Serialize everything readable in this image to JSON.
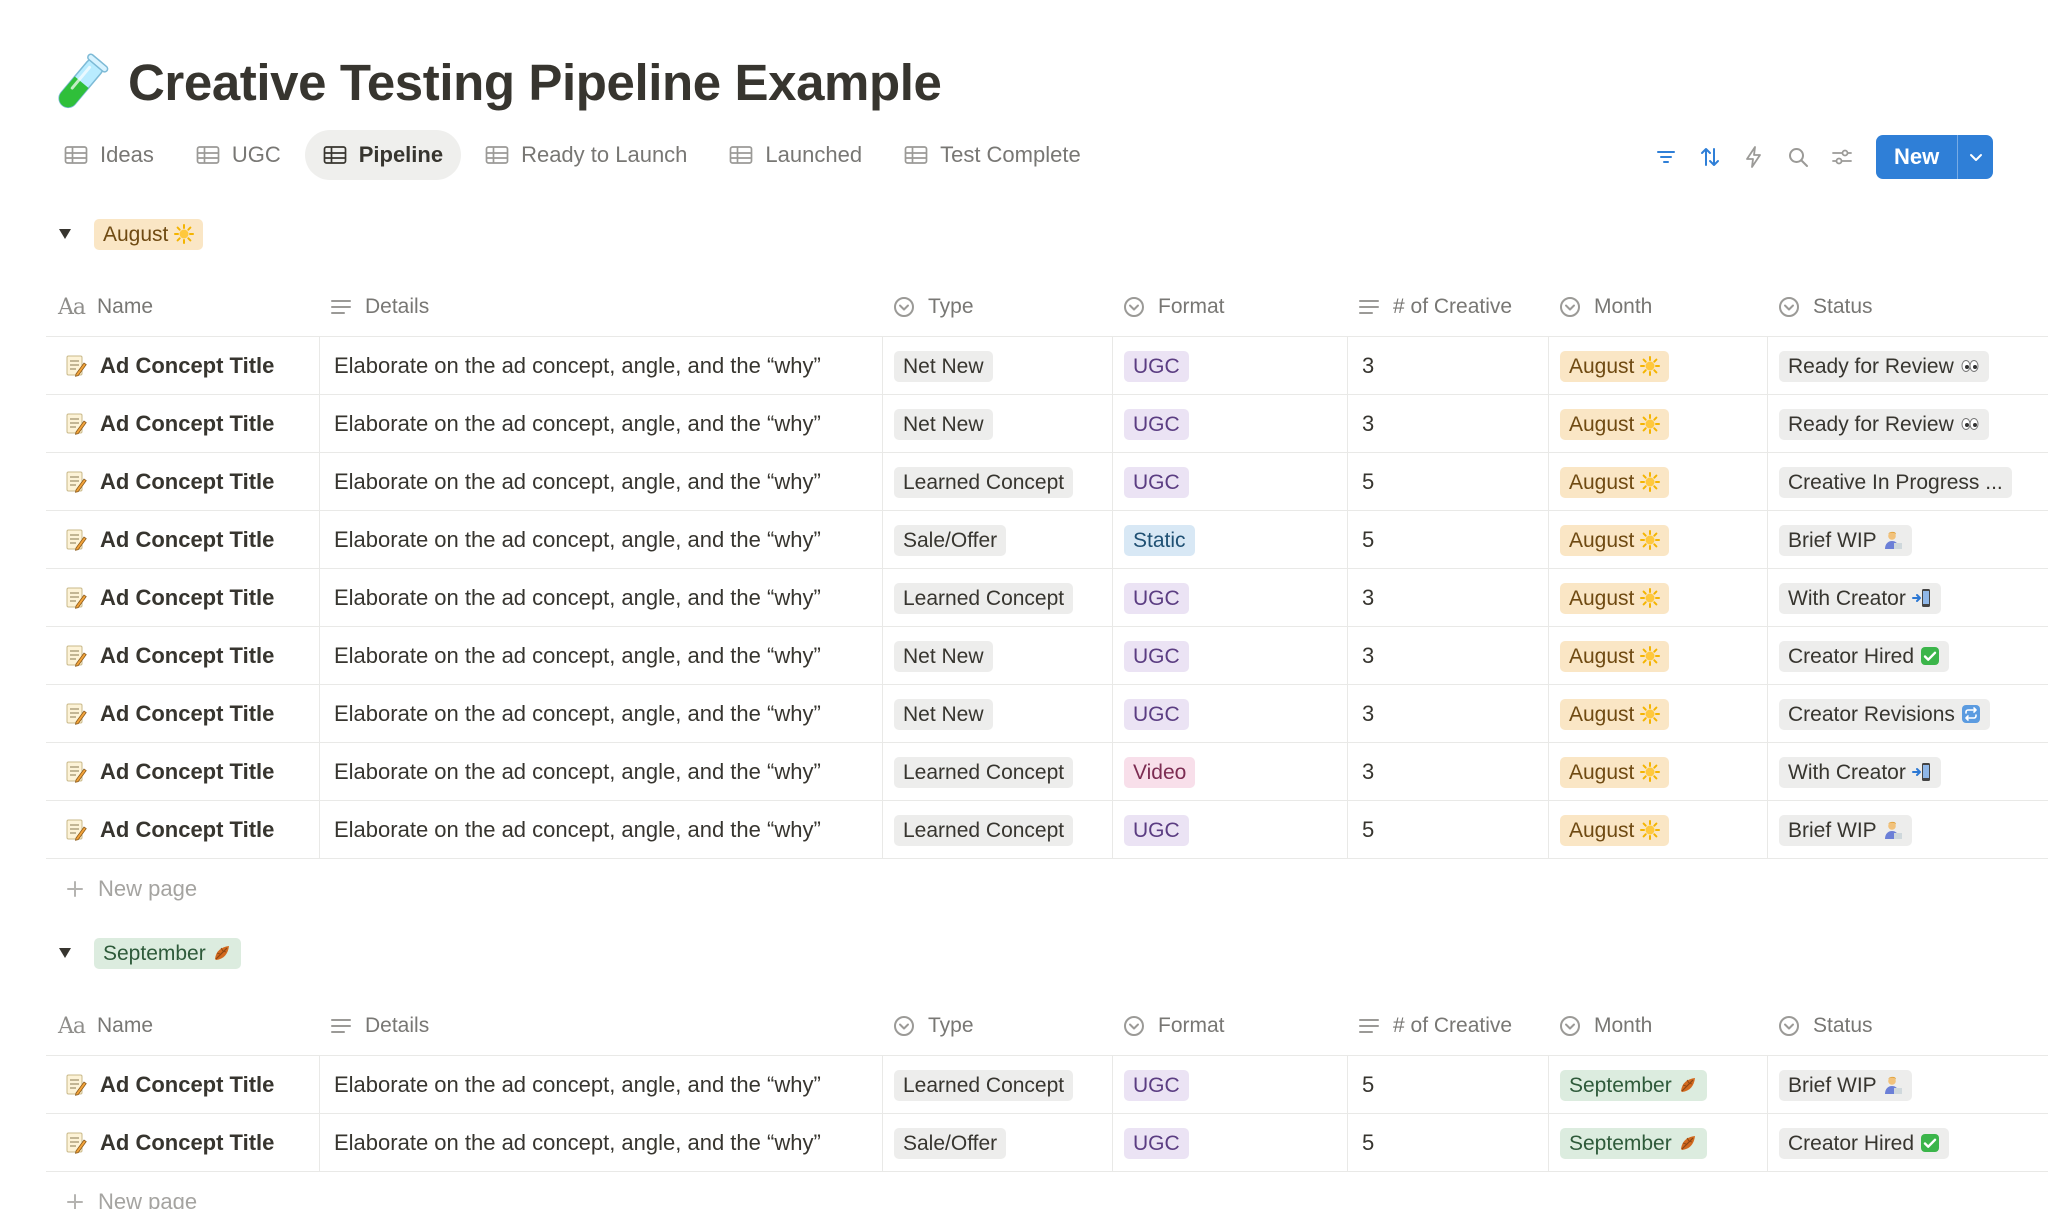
{
  "page": {
    "title": "Creative Testing Pipeline Example",
    "icon": "test-tube-icon"
  },
  "tabs": [
    {
      "label": "Ideas",
      "icon": "table-icon",
      "active": false
    },
    {
      "label": "UGC",
      "icon": "table-icon",
      "active": false
    },
    {
      "label": "Pipeline",
      "icon": "table-icon",
      "active": true
    },
    {
      "label": "Ready to Launch",
      "icon": "table-icon",
      "active": false
    },
    {
      "label": "Launched",
      "icon": "table-icon",
      "active": false
    },
    {
      "label": "Test Complete",
      "icon": "table-icon",
      "active": false
    }
  ],
  "toolbar": {
    "icons": [
      "filter-icon",
      "sort-icon",
      "lightning-icon",
      "search-icon",
      "settings-sliders-icon"
    ],
    "new_label": "New",
    "accent": "#2f7fd7"
  },
  "columns": {
    "name": "Name",
    "details": "Details",
    "type": "Type",
    "format": "Format",
    "num": "# of Creative",
    "month": "Month",
    "status": "Status"
  },
  "new_page_label": "New page",
  "colors": {
    "august": "#fae6c5",
    "september": "#dcecdf",
    "gray": "#ededec",
    "purple": "#ebe3f4",
    "blue": "#d8e8f5",
    "pink": "#f8dfea"
  },
  "groups": [
    {
      "label": "August",
      "emoji": "sun-icon",
      "rows": [
        {
          "name": "Ad Concept Title",
          "details": "Elaborate on the ad concept, angle, and the “why”",
          "type": "Net New",
          "format": "UGC",
          "num": "3",
          "month": "August",
          "status": "Ready for Review",
          "status_emoji": "eyes-icon"
        },
        {
          "name": "Ad Concept Title",
          "details": "Elaborate on the ad concept, angle, and the “why”",
          "type": "Net New",
          "format": "UGC",
          "num": "3",
          "month": "August",
          "status": "Ready for Review",
          "status_emoji": "eyes-icon"
        },
        {
          "name": "Ad Concept Title",
          "details": "Elaborate on the ad concept, angle, and the “why”",
          "type": "Learned Concept",
          "format": "UGC",
          "num": "5",
          "month": "August",
          "status": "Creative In Progress ...",
          "status_emoji": ""
        },
        {
          "name": "Ad Concept Title",
          "details": "Elaborate on the ad concept, angle, and the “why”",
          "type": "Sale/Offer",
          "format": "Static",
          "num": "5",
          "month": "August",
          "status": "Brief WIP",
          "status_emoji": "writer-icon"
        },
        {
          "name": "Ad Concept Title",
          "details": "Elaborate on the ad concept, angle, and the “why”",
          "type": "Learned Concept",
          "format": "UGC",
          "num": "3",
          "month": "August",
          "status": "With Creator",
          "status_emoji": "phone-arrow-icon"
        },
        {
          "name": "Ad Concept Title",
          "details": "Elaborate on the ad concept, angle, and the “why”",
          "type": "Net New",
          "format": "UGC",
          "num": "3",
          "month": "August",
          "status": "Creator Hired",
          "status_emoji": "check-box-icon"
        },
        {
          "name": "Ad Concept Title",
          "details": "Elaborate on the ad concept, angle, and the “why”",
          "type": "Net New",
          "format": "UGC",
          "num": "3",
          "month": "August",
          "status": "Creator Revisions",
          "status_emoji": "repeat-icon"
        },
        {
          "name": "Ad Concept Title",
          "details": "Elaborate on the ad concept, angle, and the “why”",
          "type": "Learned Concept",
          "format": "Video",
          "num": "3",
          "month": "August",
          "status": "With Creator",
          "status_emoji": "phone-arrow-icon"
        },
        {
          "name": "Ad Concept Title",
          "details": "Elaborate on the ad concept, angle, and the “why”",
          "type": "Learned Concept",
          "format": "UGC",
          "num": "5",
          "month": "August",
          "status": "Brief WIP",
          "status_emoji": "writer-icon"
        }
      ]
    },
    {
      "label": "September",
      "emoji": "fallen-leaf-icon",
      "rows": [
        {
          "name": "Ad Concept Title",
          "details": "Elaborate on the ad concept, angle, and the “why”",
          "type": "Learned Concept",
          "format": "UGC",
          "num": "5",
          "month": "September",
          "status": "Brief WIP",
          "status_emoji": "writer-icon"
        },
        {
          "name": "Ad Concept Title",
          "details": "Elaborate on the ad concept, angle, and the “why”",
          "type": "Sale/Offer",
          "format": "UGC",
          "num": "5",
          "month": "September",
          "status": "Creator Hired",
          "status_emoji": "check-box-icon"
        }
      ]
    }
  ]
}
